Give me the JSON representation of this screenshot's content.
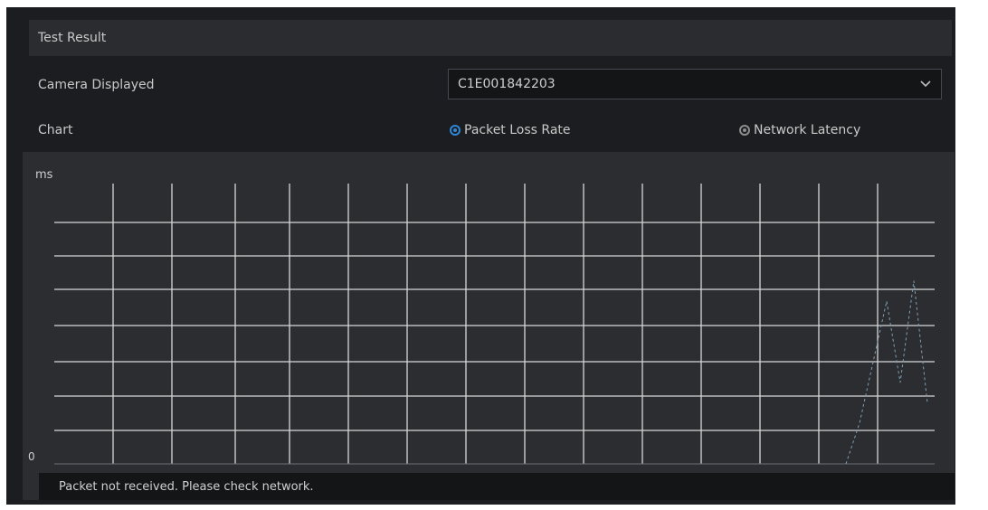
{
  "panel": {
    "title": "Test Result"
  },
  "camera_row": {
    "label": "Camera Displayed",
    "selected_value": "C1E001842203",
    "arrow_icon": "chevron-down-icon"
  },
  "chart_row": {
    "label": "Chart",
    "options": [
      {
        "label": "Packet Loss Rate",
        "checked": true
      },
      {
        "label": "Network Latency",
        "checked": false
      }
    ]
  },
  "chart_data": {
    "type": "line",
    "y_unit": "ms",
    "y_zero": "0",
    "grid": true,
    "series": [
      {
        "values": [
          0,
          0.2,
          0.5,
          0.8,
          0.4,
          0.9,
          0.3
        ]
      }
    ]
  },
  "warning": {
    "text": "Packet not received. Please check network."
  },
  "colors": {
    "panel_bg": "#1c1d20",
    "chart_bg": "#2b2d30",
    "accent": "#2f86d6",
    "grid": "#d8d8d8"
  }
}
